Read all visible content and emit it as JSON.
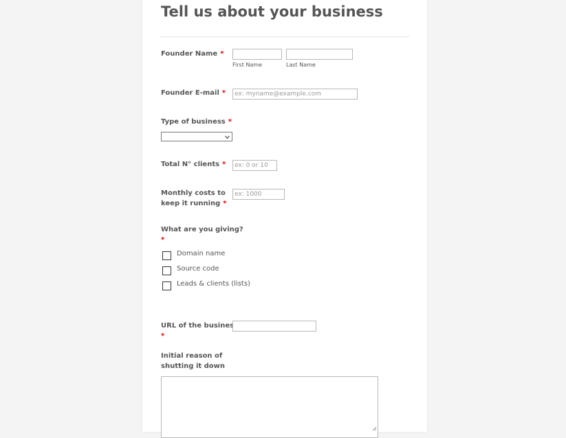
{
  "form": {
    "title": "Tell us about your business",
    "required_mark": "*",
    "founder_name": {
      "label": "Founder Name",
      "first_label": "First Name",
      "last_label": "Last Name",
      "first_value": "",
      "last_value": ""
    },
    "founder_email": {
      "label": "Founder E-mail",
      "placeholder": "ex: myname@example.com",
      "value": ""
    },
    "business_type": {
      "label": "Type of business",
      "selected": ""
    },
    "total_clients": {
      "label": "Total N° clients",
      "placeholder": "ex: 0 or 10"
    },
    "monthly_costs": {
      "label_line1": "Monthly costs to",
      "label_line2": "keep it running",
      "placeholder": "ex: 1000"
    },
    "giving": {
      "label": "What are you giving?",
      "options": [
        {
          "label": "Domain name",
          "checked": false
        },
        {
          "label": "Source code",
          "checked": false
        },
        {
          "label": "Leads & clients (lists)",
          "checked": false
        }
      ]
    },
    "url": {
      "label": "URL of the business",
      "value": ""
    },
    "reason": {
      "label_line1": "Initial reason of",
      "label_line2": "shutting it down",
      "value": ""
    }
  },
  "colors": {
    "background": "#f4f4f4",
    "panel": "#ffffff",
    "text": "#555555",
    "required": "#e00000",
    "border": "#b8b8b8"
  }
}
